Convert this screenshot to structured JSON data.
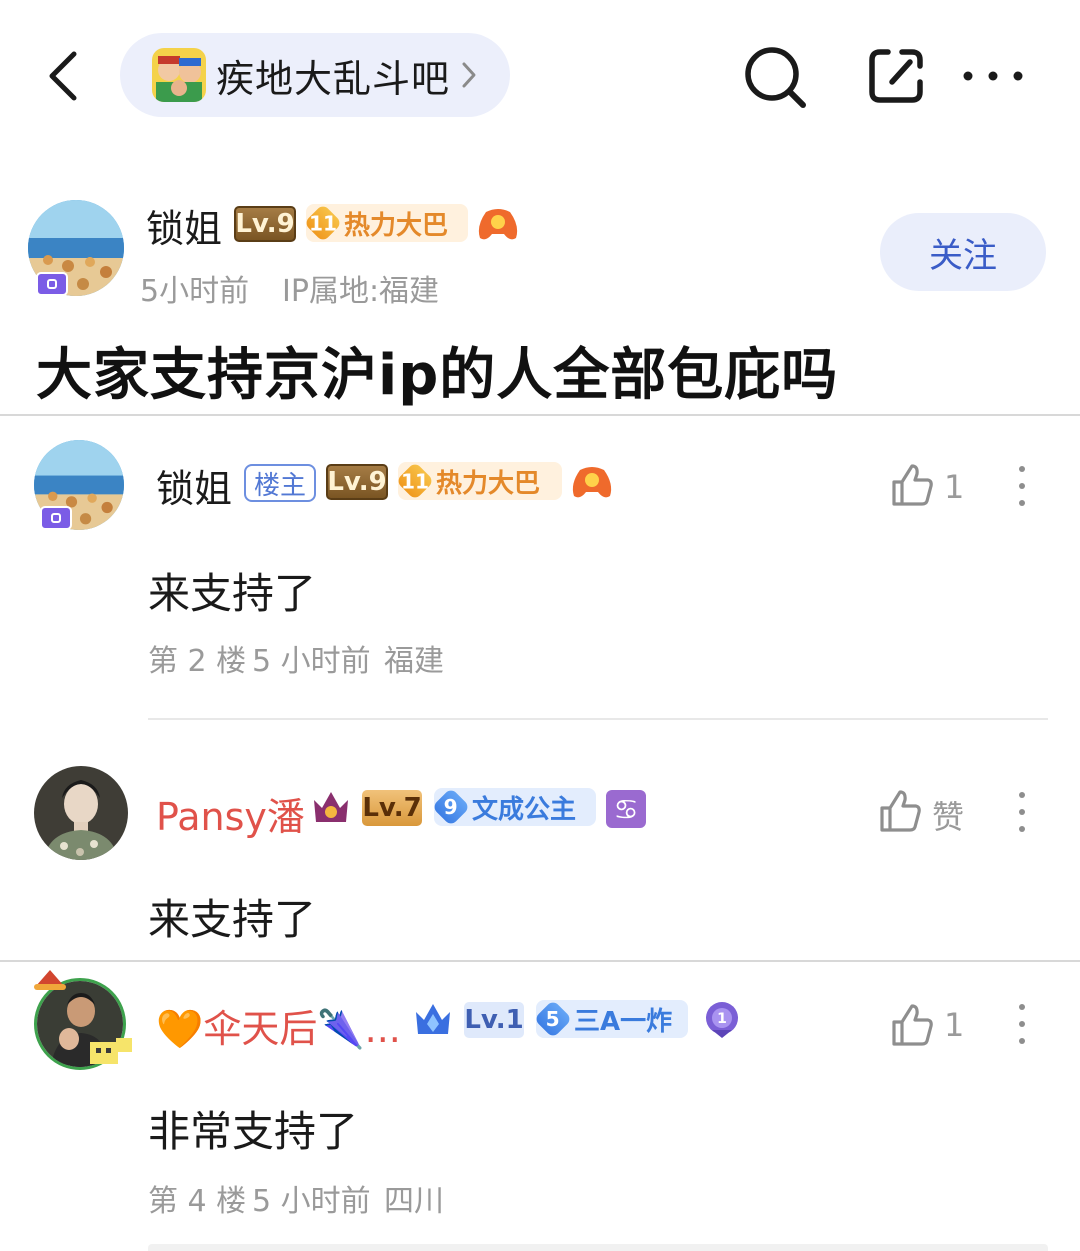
{
  "topbar": {
    "forum_name": "疾地大乱斗吧"
  },
  "post": {
    "author": "锁姐",
    "level": "Lv.9",
    "honor_num": "11",
    "honor_title": "热力大巴",
    "time": "5小时前",
    "ip": "IP属地:福建",
    "follow_label": "关注",
    "title": "大家支持京沪ip的人全部包庇吗"
  },
  "replies": [
    {
      "author": "锁姐",
      "host_tag": "楼主",
      "level": "Lv.9",
      "honor_num": "11",
      "honor_title": "热力大巴",
      "likes": "1",
      "content": "来支持了",
      "floor": "第 2 楼",
      "time": "5 小时前",
      "location": "福建"
    },
    {
      "author": "Pansy潘",
      "level": "Lv.7",
      "honor_num": "9",
      "honor_title": "文成公主",
      "likes": "赞",
      "content": "来支持了"
    },
    {
      "author": "🧡伞天后🌂...",
      "level": "Lv.1",
      "honor_num": "5",
      "honor_title": "三A一炸",
      "likes": "1",
      "content": "非常支持了",
      "floor": "第 4 楼",
      "time": "5 小时前",
      "location": "四川"
    }
  ],
  "colors": {
    "accent": "#3a5cc7",
    "username_red": "#e0524a",
    "meta_gray": "#9a9a9a"
  }
}
